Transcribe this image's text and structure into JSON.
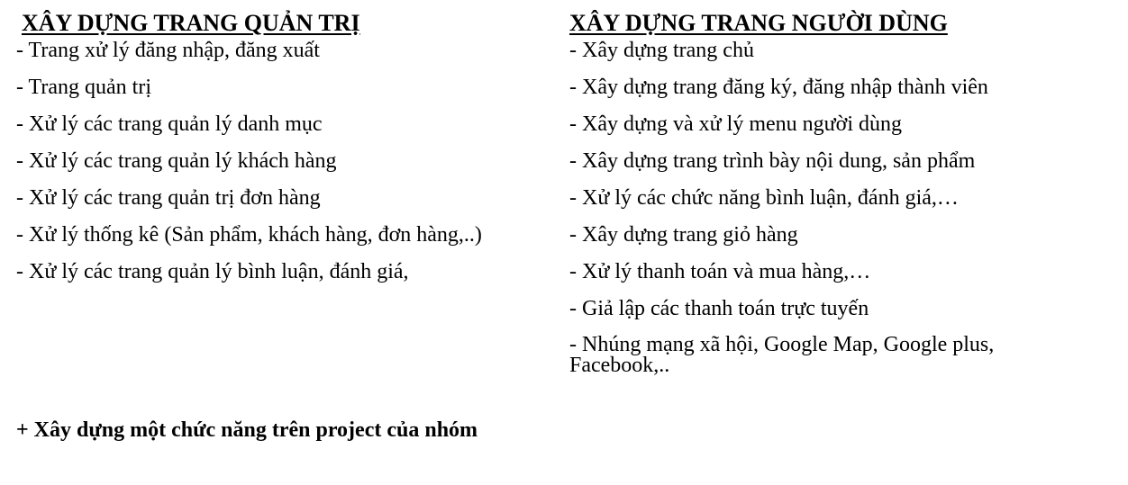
{
  "admin_section": {
    "title": "XÂY DỰNG TRANG QUẢN TRỊ",
    "items": [
      "- Trang xử lý đăng nhập, đăng xuất",
      "- Trang quản trị",
      "- Xử lý các trang quản lý danh mục",
      "- Xử lý các trang quản lý khách hàng",
      "- Xử lý các trang quản trị đơn hàng",
      "- Xử lý thống kê (Sản phẩm, khách hàng, đơn hàng,..)",
      "- Xử lý các trang quản lý bình luận, đánh giá,"
    ]
  },
  "user_section": {
    "title": "XÂY DỰNG TRANG NGƯỜI DÙNG",
    "items": [
      "- Xây dựng trang chủ",
      "- Xây dựng trang đăng ký, đăng nhập thành viên",
      "- Xây dựng và xử lý menu người dùng",
      "- Xây dựng trang trình bày nội dung, sản phẩm",
      "- Xử lý các chức năng bình luận, đánh giá,…",
      "- Xây dựng trang giỏ hàng",
      "- Xử lý thanh toán và mua hàng,…",
      "- Giả lập các thanh toán trực tuyến",
      "- Nhúng mạng xã hội, Google Map, Google plus, Facebook,.."
    ]
  },
  "footer": {
    "text": "+ Xây dựng một chức năng trên project của nhóm"
  }
}
